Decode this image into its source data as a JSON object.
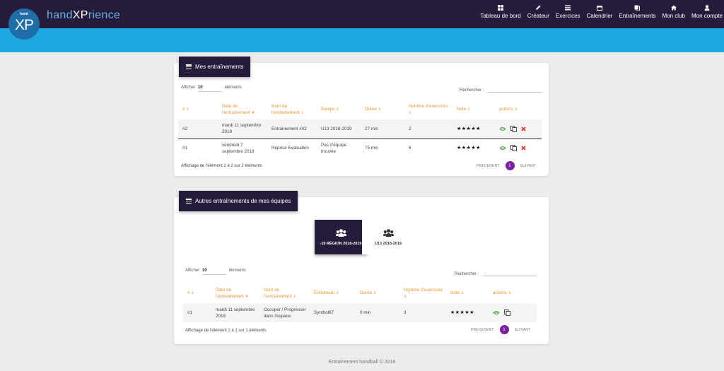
{
  "brand": {
    "logo_small": "hand",
    "logo_big": "XP",
    "name_prefix": "hand",
    "name_strong": "XP",
    "name_suffix": "rience"
  },
  "nav": [
    {
      "label": "Tableau de bord",
      "icon": "dashboard-icon"
    },
    {
      "label": "Créateur",
      "icon": "pencil-icon"
    },
    {
      "label": "Exercices",
      "icon": "list-icon"
    },
    {
      "label": "Calendrier",
      "icon": "calendar-icon"
    },
    {
      "label": "Entraînements",
      "icon": "copy-icon"
    },
    {
      "label": "Mon club",
      "icon": "home-icon"
    },
    {
      "label": "Mon compte",
      "icon": "user-icon"
    }
  ],
  "my_trainings": {
    "title": "Mes entraînements",
    "length_prefix": "Afficher",
    "length_value": "10",
    "length_suffix": "éléments",
    "search_label": "Rechercher :",
    "columns": [
      "#",
      "Date de l'entraînement",
      "Nom de l'entraînement",
      "Equipe",
      "Durée",
      "Nombre d'exercices",
      "Note",
      "actions"
    ],
    "rows": [
      {
        "num": "#2",
        "date": "mardi 11 septembre 2018",
        "name": "Entrainement #02",
        "team": "U13 2018-2019",
        "duration": "27 min",
        "count": "2",
        "note": "★★★★★"
      },
      {
        "num": "#1",
        "date": "vendredi 7 septembre 2018",
        "name": "Reprise Evaluation",
        "team": "Pas d'équipe trouvée",
        "duration": "75 min",
        "count": "6",
        "note": "★★★★★"
      }
    ],
    "info": "Affichage de l'élément 1 à 2 sur 2 éléments",
    "prev": "PRÉCÉDENT",
    "page": "1",
    "next": "SUIVANT"
  },
  "other_trainings": {
    "title": "Autres entraînements de mes équipes",
    "teams": [
      {
        "label": "-19 RÉGION 2018-2019",
        "active": true
      },
      {
        "label": "U13 2018-2019",
        "active": false
      }
    ],
    "length_prefix": "Afficher",
    "length_value": "10",
    "length_suffix": "éléments",
    "search_label": "Rechercher :",
    "columns": [
      "#",
      "Date de l'entraînement",
      "Nom de l'entraînement",
      "Entraîneur",
      "Durée",
      "Nombre d'exercices",
      "Note",
      "actions"
    ],
    "rows": [
      {
        "num": "#1",
        "date": "mardi 11 septembre 2018",
        "name": "Occuper / Progresser dans l'espace",
        "coach": "Synthol67",
        "duration": "0 min",
        "count": "3",
        "note": "★★★★★"
      }
    ],
    "info": "Affichage de l'élément 1 à 1 sur 1 éléments",
    "prev": "PRÉCÉDENT",
    "page": "1",
    "next": "SUIVANT"
  },
  "footer": "Entrainement handball © 2018",
  "colors": {
    "nav_bg": "#241c3a",
    "accent_blue": "#1ea7e1",
    "header_orange": "#f0932b",
    "pager_purple": "#7b1fa2",
    "view_green": "#4caf50",
    "delete_red": "#e53935"
  }
}
